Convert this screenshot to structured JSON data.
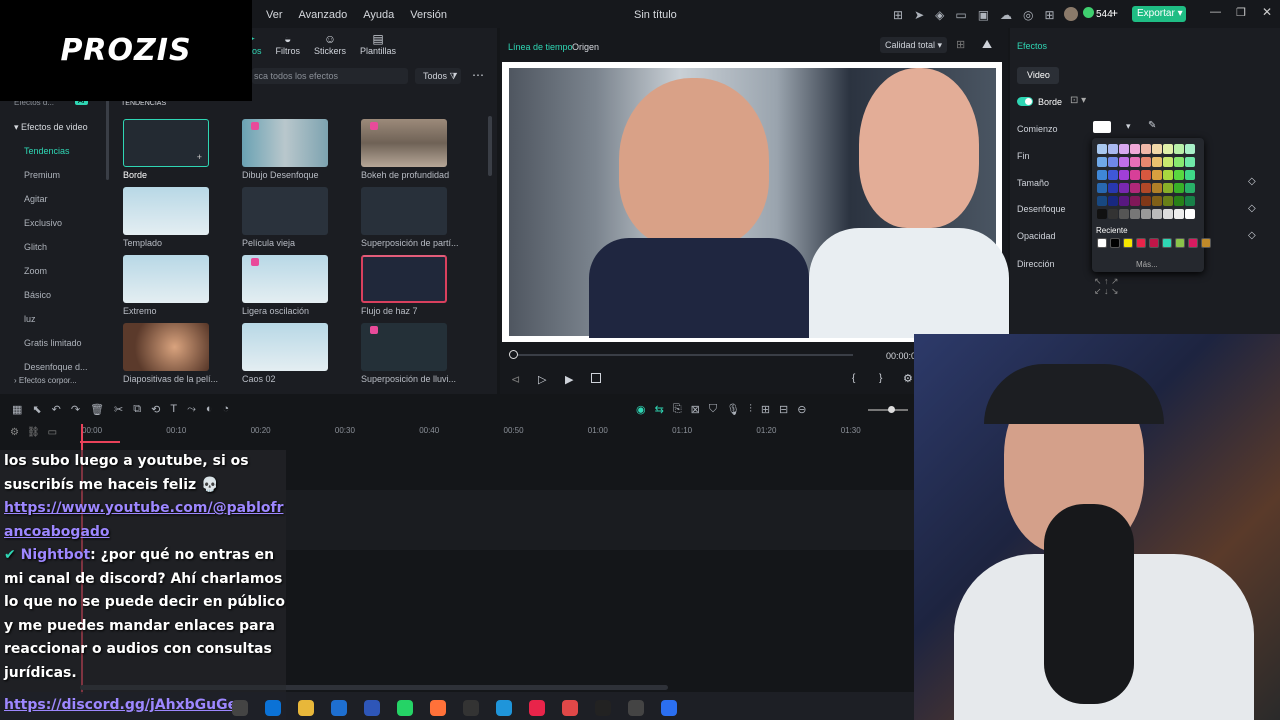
{
  "logo": "PROZIS",
  "menu": [
    "Ver",
    "Avanzado",
    "Ayuda",
    "Versión"
  ],
  "window_title": "Sin título",
  "credits": "544",
  "export_label": "Exportar",
  "toolbar_tabs": [
    "ectos",
    "Filtros",
    "Stickers",
    "Plantillas"
  ],
  "search_placeholder": "sca todos los efectos",
  "filter_label": "Todos",
  "sidebar": {
    "top": "Efectos d...",
    "ai_badge": "AI",
    "group": "Efectos de video",
    "items": [
      "Tendencias",
      "Premium",
      "Agitar",
      "Exclusivo",
      "Glitch",
      "Zoom",
      "Básico",
      "luz",
      "Gratis limitado",
      "Desenfoque d..."
    ],
    "bottom": "Efectos corpor..."
  },
  "section_title": "TENDENCIAS",
  "effects": [
    "Borde",
    "Dibujo Desenfoque",
    "Bokeh de profundidad",
    "Templado",
    "Película vieja",
    "Superposición de partí...",
    "Extremo",
    "Ligera oscilación",
    "Flujo de haz 7",
    "Diapositivas de la pelí...",
    "Caos 02",
    "Superposición de lluvi..."
  ],
  "preview": {
    "tab1": "Línea de tiempo",
    "tab2": "Origen",
    "quality": "Calidad total",
    "time": "00:00:0"
  },
  "timeline_ticks": [
    "00:00",
    "00:10",
    "00:20",
    "00:30",
    "00:40",
    "00:50",
    "01:00",
    "01:10",
    "01:20",
    "01:30"
  ],
  "right": {
    "title": "Efectos",
    "tab": "Video",
    "toggle_label": "Borde",
    "rows": [
      "Comienzo",
      "Fin",
      "Tamaño",
      "Desenfoque",
      "Opacidad",
      "Dirección"
    ],
    "recent": "Reciente",
    "more": "Más..."
  },
  "chat": {
    "line1": "los subo luego a youtube, si os suscribís me haceis feliz",
    "link1": "https://www.youtube.com/@pablofrancoabogado",
    "user": "Nightbot",
    "msg": ": ¿por qué no entras en mi canal de discord? Ahí charlamos lo que no se puede decir en público y me puedes mandar enlaces para reaccionar o audios con consultas jurídicas.",
    "link2": "https://discord.gg/jAhxbGuGeu"
  },
  "colors": {
    "accent": "#2fd6b4",
    "export": "#1fbd84"
  }
}
